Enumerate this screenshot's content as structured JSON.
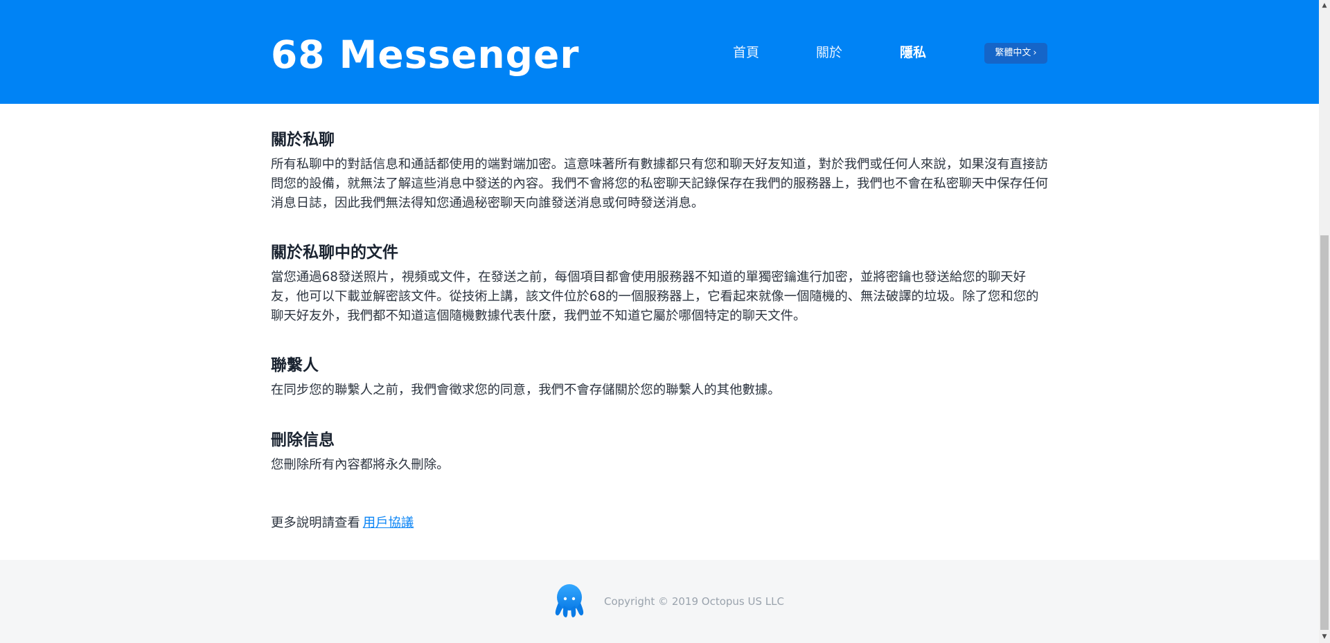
{
  "header": {
    "logo_text": "68 Messenger",
    "nav": {
      "home": "首頁",
      "about": "關於",
      "privacy": "隱私"
    },
    "language": {
      "label": "繁體中文",
      "chevron": "›"
    },
    "bg_color": "#0083f5"
  },
  "sections": [
    {
      "title": "關於私聊",
      "body": "所有私聊中的對話信息和通話都使用的端對端加密。這意味著所有數據都只有您和聊天好友知道，對於我們或任何人來說，如果沒有直接訪問您的設備，就無法了解這些消息中發送的內容。我們不會將您的私密聊天記錄保存在我們的服務器上，我們也不會在私密聊天中保存任何消息日誌，因此我們無法得知您通過秘密聊天向誰發送消息或何時發送消息。"
    },
    {
      "title": "關於私聊中的文件",
      "body": "當您通過68發送照片，視頻或文件，在發送之前，每個項目都會使用服務器不知道的單獨密鑰進行加密，並將密鑰也發送給您的聊天好友，他可以下載並解密該文件。從技術上講，該文件位於68的一個服務器上，它看起來就像一個隨機的、無法破譯的垃圾。除了您和您的聊天好友外，我們都不知道這個隨機數據代表什麼，我們並不知道它屬於哪個特定的聊天文件。"
    },
    {
      "title": "聯繫人",
      "body": "在同步您的聯繫人之前，我們會徵求您的同意，我們不會存儲關於您的聯繫人的其他數據。"
    },
    {
      "title": "刪除信息",
      "body": "您刪除所有內容都將永久刪除。"
    }
  ],
  "more": {
    "prefix": "更多說明請查看",
    "link": "用戶協議"
  },
  "footer": {
    "mascot_icon": "octopus-icon",
    "copyright": "Copyright © 2019 Octopus US LLC"
  },
  "scrollbar": {
    "up": "▲",
    "down": "▼"
  },
  "colors": {
    "accent": "#0083f5",
    "link": "#0a84f5",
    "footer_bg": "#f5f6f7"
  }
}
